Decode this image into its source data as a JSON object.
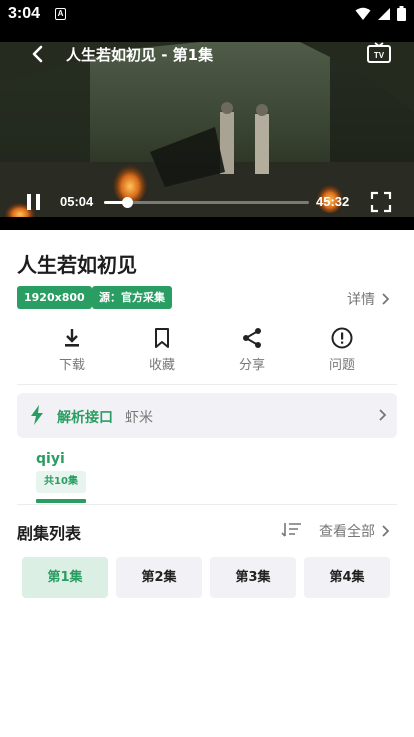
{
  "status_bar": {
    "time": "3:04",
    "notification_badge": "A"
  },
  "player": {
    "title": "人生若如初见 - 第1集",
    "current_time": "05:04",
    "total_time": "45:32",
    "progress_fraction": 0.111,
    "icons": {
      "back": "back-arrow-icon",
      "cast": "tv-cast-icon",
      "play_state": "pause-icon",
      "fullscreen": "fullscreen-icon"
    }
  },
  "show": {
    "title": "人生若如初见",
    "tags": [
      "1920x800",
      "源：官方采集"
    ],
    "details_label": "详情"
  },
  "actions": [
    {
      "label": "下载",
      "icon": "download-icon"
    },
    {
      "label": "收藏",
      "icon": "bookmark-icon"
    },
    {
      "label": "分享",
      "icon": "share-icon"
    },
    {
      "label": "问题",
      "icon": "report-issue-icon"
    }
  ],
  "source_bar": {
    "label": "解析接口",
    "value": "虾米"
  },
  "provider": {
    "name": "qiyi",
    "count": "共10集"
  },
  "episodes": {
    "header": "剧集列表",
    "view_all": "查看全部",
    "items": [
      "第1集",
      "第2集",
      "第3集",
      "第4集"
    ],
    "active_index": 0
  },
  "colors": {
    "accent": "#2a9d62",
    "accent_light": "#dcefe4",
    "muted": "#777777",
    "chip_bg": "#f2f2f6"
  }
}
